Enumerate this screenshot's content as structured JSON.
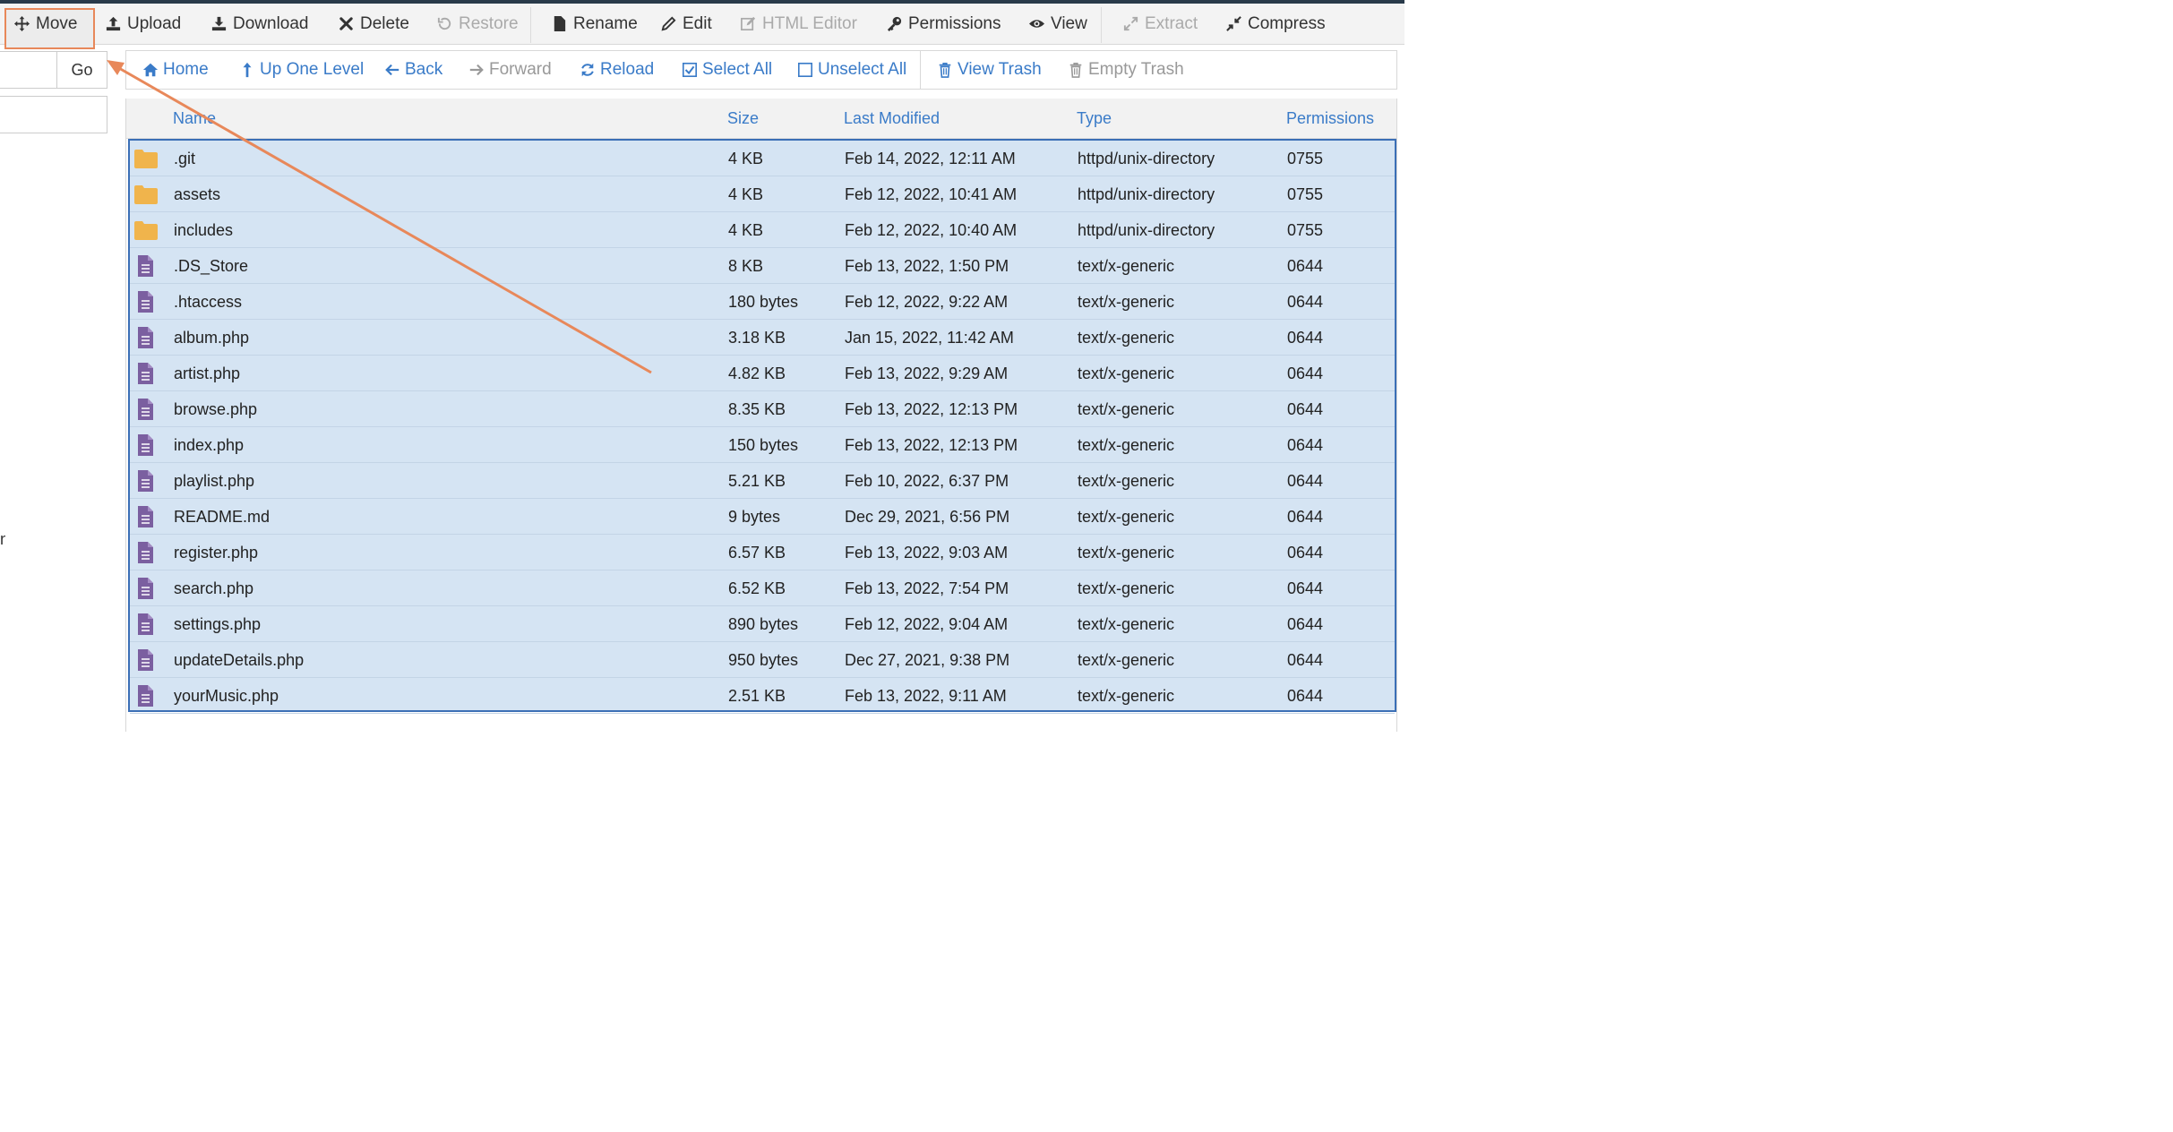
{
  "toolbar": {
    "items": [
      {
        "label": "Move",
        "icon": "move-icon",
        "disabled": false
      },
      {
        "label": "Upload",
        "icon": "upload-icon",
        "disabled": false
      },
      {
        "label": "Download",
        "icon": "download-icon",
        "disabled": false
      },
      {
        "label": "Delete",
        "icon": "close-icon",
        "disabled": false
      },
      {
        "label": "Restore",
        "icon": "restore-icon",
        "disabled": true
      },
      {
        "label": "Rename",
        "icon": "file-icon",
        "disabled": false
      },
      {
        "label": "Edit",
        "icon": "pencil-icon",
        "disabled": false
      },
      {
        "label": "HTML Editor",
        "icon": "edit-square-icon",
        "disabled": true
      },
      {
        "label": "Permissions",
        "icon": "key-icon",
        "disabled": false
      },
      {
        "label": "View",
        "icon": "eye-icon",
        "disabled": false
      },
      {
        "label": "Extract",
        "icon": "expand-icon",
        "disabled": true
      },
      {
        "label": "Compress",
        "icon": "compress-icon",
        "disabled": false
      }
    ]
  },
  "left_panel": {
    "go_label": "Go",
    "fragment": "n"
  },
  "nav": {
    "items": [
      {
        "label": "Home",
        "icon": "home-icon",
        "disabled": false
      },
      {
        "label": "Up One Level",
        "icon": "level-up-icon",
        "disabled": false
      },
      {
        "label": "Back",
        "icon": "arrow-left-icon",
        "disabled": false
      },
      {
        "label": "Forward",
        "icon": "arrow-right-icon",
        "disabled": true
      },
      {
        "label": "Reload",
        "icon": "refresh-icon",
        "disabled": false
      },
      {
        "label": "Select All",
        "icon": "checkbox-checked-icon",
        "disabled": false
      },
      {
        "label": "Unselect All",
        "icon": "checkbox-empty-icon",
        "disabled": false
      },
      {
        "label": "View Trash",
        "icon": "trash-icon",
        "disabled": false
      },
      {
        "label": "Empty Trash",
        "icon": "trash-icon",
        "disabled": true
      }
    ]
  },
  "table": {
    "headers": {
      "name": "Name",
      "size": "Size",
      "modified": "Last Modified",
      "type": "Type",
      "permissions": "Permissions"
    },
    "rows": [
      {
        "kind": "folder",
        "name": ".git",
        "size": "4 KB",
        "modified": "Feb 14, 2022, 12:11 AM",
        "type": "httpd/unix-directory",
        "perms": "0755"
      },
      {
        "kind": "folder",
        "name": "assets",
        "size": "4 KB",
        "modified": "Feb 12, 2022, 10:41 AM",
        "type": "httpd/unix-directory",
        "perms": "0755"
      },
      {
        "kind": "folder",
        "name": "includes",
        "size": "4 KB",
        "modified": "Feb 12, 2022, 10:40 AM",
        "type": "httpd/unix-directory",
        "perms": "0755"
      },
      {
        "kind": "file",
        "name": ".DS_Store",
        "size": "8 KB",
        "modified": "Feb 13, 2022, 1:50 PM",
        "type": "text/x-generic",
        "perms": "0644"
      },
      {
        "kind": "file",
        "name": ".htaccess",
        "size": "180 bytes",
        "modified": "Feb 12, 2022, 9:22 AM",
        "type": "text/x-generic",
        "perms": "0644"
      },
      {
        "kind": "file",
        "name": "album.php",
        "size": "3.18 KB",
        "modified": "Jan 15, 2022, 11:42 AM",
        "type": "text/x-generic",
        "perms": "0644"
      },
      {
        "kind": "file",
        "name": "artist.php",
        "size": "4.82 KB",
        "modified": "Feb 13, 2022, 9:29 AM",
        "type": "text/x-generic",
        "perms": "0644"
      },
      {
        "kind": "file",
        "name": "browse.php",
        "size": "8.35 KB",
        "modified": "Feb 13, 2022, 12:13 PM",
        "type": "text/x-generic",
        "perms": "0644"
      },
      {
        "kind": "file",
        "name": "index.php",
        "size": "150 bytes",
        "modified": "Feb 13, 2022, 12:13 PM",
        "type": "text/x-generic",
        "perms": "0644"
      },
      {
        "kind": "file",
        "name": "playlist.php",
        "size": "5.21 KB",
        "modified": "Feb 10, 2022, 6:37 PM",
        "type": "text/x-generic",
        "perms": "0644"
      },
      {
        "kind": "file",
        "name": "README.md",
        "size": "9 bytes",
        "modified": "Dec 29, 2021, 6:56 PM",
        "type": "text/x-generic",
        "perms": "0644"
      },
      {
        "kind": "file",
        "name": "register.php",
        "size": "6.57 KB",
        "modified": "Feb 13, 2022, 9:03 AM",
        "type": "text/x-generic",
        "perms": "0644"
      },
      {
        "kind": "file",
        "name": "search.php",
        "size": "6.52 KB",
        "modified": "Feb 13, 2022, 7:54 PM",
        "type": "text/x-generic",
        "perms": "0644"
      },
      {
        "kind": "file",
        "name": "settings.php",
        "size": "890 bytes",
        "modified": "Feb 12, 2022, 9:04 AM",
        "type": "text/x-generic",
        "perms": "0644"
      },
      {
        "kind": "file",
        "name": "updateDetails.php",
        "size": "950 bytes",
        "modified": "Dec 27, 2021, 9:38 PM",
        "type": "text/x-generic",
        "perms": "0644"
      },
      {
        "kind": "file",
        "name": "yourMusic.php",
        "size": "2.51 KB",
        "modified": "Feb 13, 2022, 9:11 AM",
        "type": "text/x-generic",
        "perms": "0644"
      }
    ]
  },
  "colors": {
    "accent": "#3a7bc8",
    "selection_bg": "#d5e4f3",
    "selection_border": "#3b6fb6",
    "folder": "#f0b44c",
    "file": "#7b5fa0",
    "annotation": "#e8885a"
  }
}
